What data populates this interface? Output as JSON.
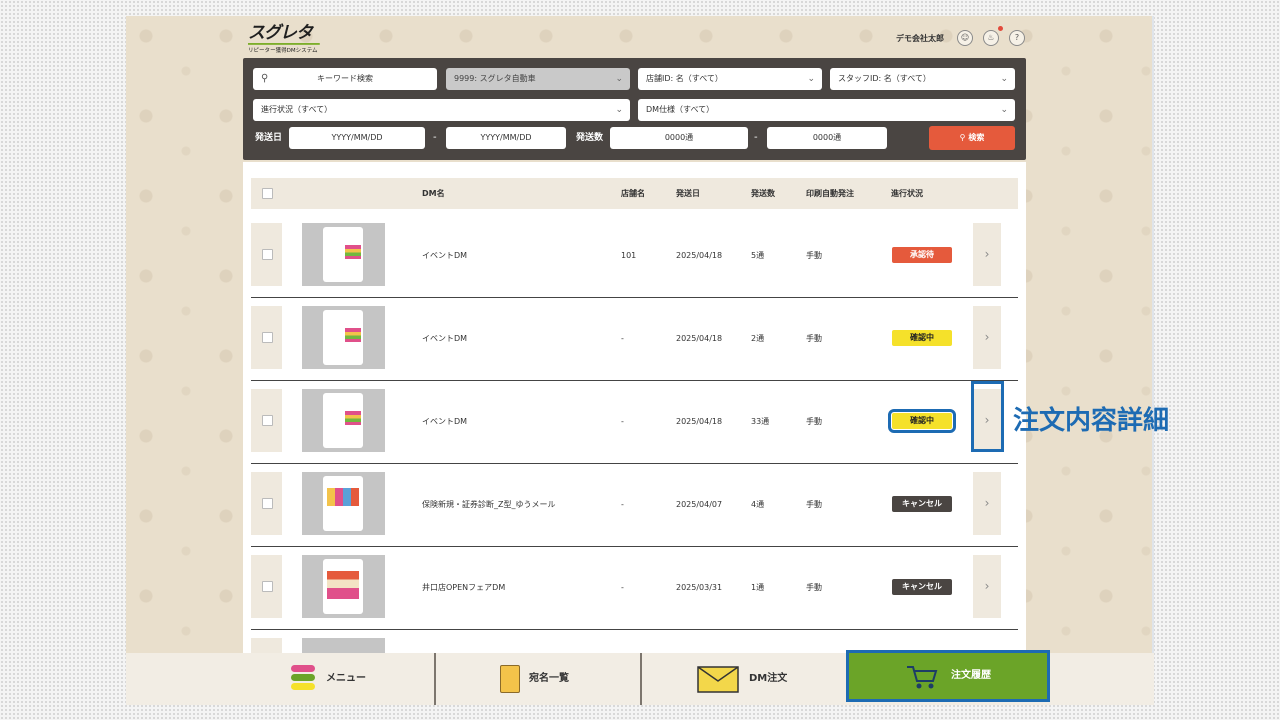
{
  "header": {
    "logo_main": "スグレタ",
    "logo_sub": "リピーター獲得DMシステム",
    "user_name": "デモ会社太郎"
  },
  "search": {
    "keyword_placeholder": "キーワード検索",
    "company_value": "9999: スグレタ自動車",
    "store_value": "店舗ID: 名（すべて）",
    "staff_value": "スタッフID: 名（すべて）",
    "status_value": "進行状況（すべて）",
    "dm_spec_value": "DM仕様（すべて）",
    "send_date_label": "発送日",
    "date_from": "YYYY/MM/DD",
    "date_to": "YYYY/MM/DD",
    "send_count_label": "発送数",
    "count_from": "0000通",
    "count_to": "0000通",
    "range_dash": "-",
    "search_button": "検索"
  },
  "table": {
    "columns": [
      "DM名",
      "店舗名",
      "発送日",
      "発送数",
      "印刷自動発注",
      "進行状況"
    ],
    "rows": [
      {
        "name": "イベントDM",
        "store": "101",
        "date": "2025/04/18",
        "count": "5通",
        "auto": "手動",
        "status": "承認待",
        "status_color": "#e55a3c",
        "status_text_color": "#ffffff"
      },
      {
        "name": "イベントDM",
        "store": "-",
        "date": "2025/04/18",
        "count": "2通",
        "auto": "手動",
        "status": "確認中",
        "status_color": "#f5e12a",
        "status_text_color": "#222222"
      },
      {
        "name": "イベントDM",
        "store": "-",
        "date": "2025/04/18",
        "count": "33通",
        "auto": "手動",
        "status": "確認中",
        "status_color": "#f5e12a",
        "status_text_color": "#222222"
      },
      {
        "name": "保険新規・証券診断_Z型_ゆうメール",
        "store": "-",
        "date": "2025/04/07",
        "count": "4通",
        "auto": "手動",
        "status": "キャンセル",
        "status_color": "#4a4542",
        "status_text_color": "#ffffff"
      },
      {
        "name": "井口店OPENフェアDM",
        "store": "-",
        "date": "2025/03/31",
        "count": "1通",
        "auto": "手動",
        "status": "キャンセル",
        "status_color": "#4a4542",
        "status_text_color": "#ffffff"
      }
    ]
  },
  "annotation": {
    "callout_text": "注文内容詳細",
    "highlight_color": "#1d6bb3"
  },
  "bottom_nav": {
    "menu": "メニュー",
    "address_list": "宛名一覧",
    "dm_order": "DM注文",
    "order_history": "注文履歴"
  },
  "colors": {
    "accent_green": "#6ba428",
    "panel_dark": "#4a4542",
    "search_red": "#e55a3c"
  }
}
